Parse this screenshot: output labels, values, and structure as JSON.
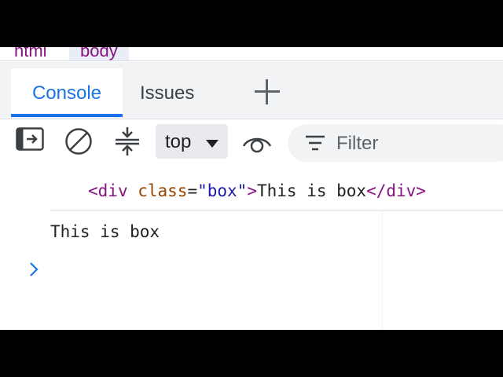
{
  "breadcrumb": {
    "items": [
      "html",
      "body"
    ]
  },
  "tabs": {
    "console": "Console",
    "issues": "Issues",
    "add_icon": "plus-icon"
  },
  "toolbar": {
    "context": "top",
    "filter_placeholder": "Filter",
    "icons": [
      "sidebar-toggle-icon",
      "clear-console-icon",
      "collapse-icon",
      "chevron-down-icon",
      "eye-icon",
      "filter-icon"
    ]
  },
  "console": {
    "html_log": {
      "open_lt": "<",
      "tag": "div",
      "attr_name": " class",
      "equals": "=",
      "attr_value": "\"box\"",
      "open_gt": ">",
      "text": "This is box",
      "close_tag": "</div>"
    },
    "text_log": "This is box",
    "prompt_icon": "chevron-right-icon"
  },
  "colors": {
    "accent": "#1a73e8",
    "tag": "#881280",
    "attr": "#994500",
    "value": "#1a1aa6"
  }
}
